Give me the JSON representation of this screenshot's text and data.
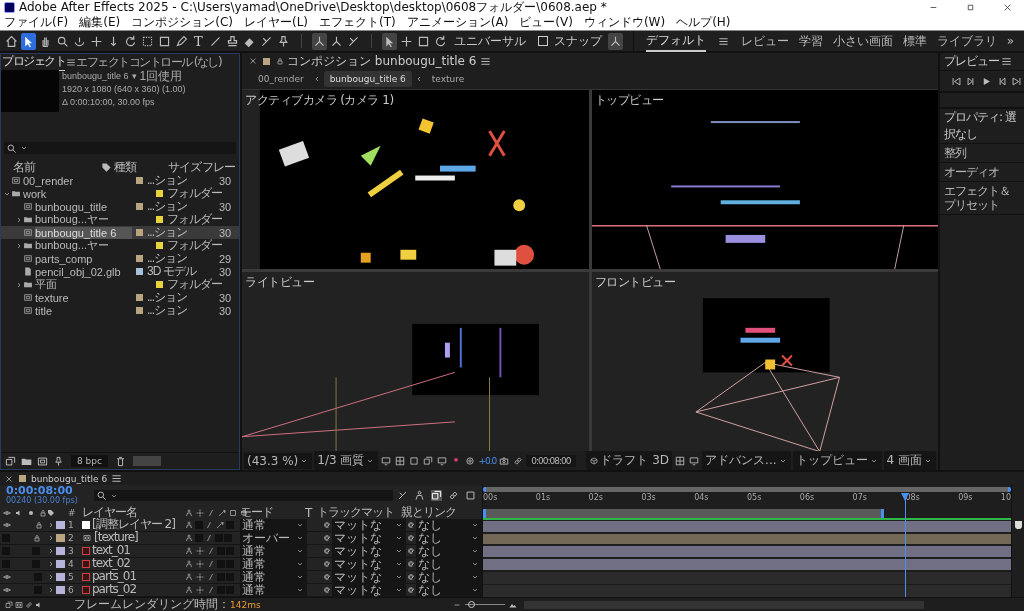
{
  "window": {
    "title": "Adobe After Effects 2025 - C:\\Users\\yamad\\OneDrive\\Desktop\\desktop\\0608フォルダー\\0608.aep *"
  },
  "menu": [
    "ファイル(F)",
    "編集(E)",
    "コンポジション(C)",
    "レイヤー(L)",
    "エフェクト(T)",
    "アニメーション(A)",
    "ビュー(V)",
    "ウィンドウ(W)",
    "ヘルプ(H)"
  ],
  "toolbar": {
    "tools": [
      {
        "kind": "home",
        "selected": false
      },
      {
        "kind": "select",
        "selected": true
      },
      {
        "kind": "hand",
        "selected": false
      },
      {
        "kind": "search",
        "selected": false
      },
      {
        "kind": "orbit",
        "selected": false
      },
      {
        "kind": "move",
        "selected": false
      },
      {
        "kind": "dolly",
        "selected": false
      },
      {
        "kind": "rotate",
        "selected": false
      },
      {
        "kind": "anchor",
        "selected": false
      },
      {
        "kind": "square",
        "selected": false
      },
      {
        "kind": "pen",
        "selected": false
      },
      {
        "kind": "text",
        "selected": false,
        "glyph": "T"
      },
      {
        "kind": "brush",
        "selected": false
      },
      {
        "kind": "stamp",
        "selected": false
      },
      {
        "kind": "eraser",
        "selected": false
      },
      {
        "kind": "branch",
        "selected": false
      },
      {
        "kind": "pin",
        "selected": false
      }
    ],
    "axis_tools": [
      {
        "kind": "axis",
        "selected": true
      },
      {
        "kind": "axis",
        "selected": false
      },
      {
        "kind": "branch",
        "selected": false
      }
    ],
    "gizmo_tools": [
      {
        "kind": "select",
        "selected": true
      },
      {
        "kind": "move",
        "selected": false
      },
      {
        "kind": "square",
        "selected": false
      },
      {
        "kind": "rotate",
        "selected": false
      }
    ],
    "universal_label": "ユニバーサル",
    "snap": {
      "label": "スナップ",
      "checked": false
    },
    "snap_extra": {
      "selected": true
    }
  },
  "workspaces": [
    {
      "label": "デフォルト",
      "selected": true
    },
    {
      "label": "レビュー",
      "selected": false
    },
    {
      "label": "学習",
      "selected": false
    },
    {
      "label": "小さい画面",
      "selected": false
    },
    {
      "label": "標準",
      "selected": false
    },
    {
      "label": "ライブラリ",
      "selected": false
    }
  ],
  "workspace_more": "»",
  "project": {
    "tabs": [
      {
        "label": "プロジェクト",
        "selected": true
      },
      {
        "label": "エフェクトコントロール (なし)",
        "selected": false
      }
    ],
    "info": {
      "name": "bunbougu_title 6",
      "caret": "▾",
      "usage": "1回使用",
      "size": "1920 x 1080  (640 x 360) (1.00)",
      "duration": "Δ 0:00:10:00, 30.00 fps"
    },
    "columns": [
      "名前",
      "種類",
      "サイズ",
      "フレー"
    ],
    "items": [
      {
        "name": "00_render",
        "kind": "comp",
        "color": "#b9a57f",
        "type": "...ション",
        "frame": "30",
        "selected": false
      },
      {
        "name": "work",
        "kind": "folder",
        "color": "#e6d43c",
        "type": "フォルダー",
        "selected": false,
        "expanded": true,
        "children": [
          {
            "name": "bunbougu_title",
            "kind": "comp",
            "color": "#b9a57f",
            "type": "...ション",
            "frame": "30",
            "selected": false
          },
          {
            "name": "bunboug...ヤー",
            "kind": "folder",
            "color": "#e6d43c",
            "type": "フォルダー",
            "selected": false,
            "expanded": false
          },
          {
            "name": "bunbougu_title 6",
            "kind": "comp",
            "color": "#b9a57f",
            "type": "...ション",
            "frame": "30",
            "selected": true
          },
          {
            "name": "bunboug...ヤー",
            "kind": "folder",
            "color": "#e6d43c",
            "type": "フォルダー",
            "selected": false,
            "expanded": false
          },
          {
            "name": "parts_comp",
            "kind": "comp",
            "color": "#b9a57f",
            "type": "...ション",
            "frame": "29",
            "selected": false
          },
          {
            "name": "pencil_obj_02.glb",
            "kind": "file",
            "color": "#a7c3dc",
            "type": "3D モデル",
            "frame": "30",
            "selected": false
          },
          {
            "name": "平面",
            "kind": "folder",
            "color": "#e6d43c",
            "type": "フォルダー",
            "selected": false,
            "expanded": false
          },
          {
            "name": "texture",
            "kind": "comp",
            "color": "#b9a57f",
            "type": "...ション",
            "frame": "30",
            "selected": false
          },
          {
            "name": "title",
            "kind": "comp",
            "color": "#b9a57f",
            "type": "...ション",
            "frame": "30",
            "selected": false
          }
        ]
      }
    ],
    "bpc": "8 bpc"
  },
  "viewer": {
    "tab": "コンポジション bunbougu_title 6",
    "breadcrumbs": [
      {
        "label": "00_render",
        "selected": false
      },
      {
        "label": "bunbougu_title 6",
        "selected": true
      },
      {
        "label": "texture",
        "selected": false
      }
    ],
    "views": [
      {
        "label": "アクティブカメラ (カメラ 1)",
        "kind": "camera"
      },
      {
        "label": "トップビュー",
        "kind": "top"
      },
      {
        "label": "ライトビュー",
        "kind": "right"
      },
      {
        "label": "フロントビュー",
        "kind": "front"
      }
    ],
    "bottom": {
      "zoom": "(43.3 %)",
      "quality": "1/3 画質",
      "exposure": "+0.0",
      "time": "0:00:08:00",
      "draft": "ドラフト 3D",
      "renderer": "アドバンス...",
      "view": "トップビュー",
      "layout": "4 画面"
    }
  },
  "right_panel": {
    "preview_title": "プレビュー",
    "properties_title": "プロパティ: 選択なし",
    "sections": [
      "整列",
      "オーディオ",
      "エフェクト＆プリセット"
    ]
  },
  "timeline": {
    "comp": "bunbougu_title 6",
    "time": "0:00:08:00",
    "frame": "00240 (30.00 fps)",
    "columns": {
      "index": "#",
      "name": "レイヤー名",
      "mode": "モード",
      "t": "T",
      "matte": "トラックマット",
      "parent": "親とリンク"
    },
    "ruler": [
      "00s",
      "01s",
      "02s",
      "03s",
      "04s",
      "05s",
      "06s",
      "07s",
      "08s",
      "09s",
      "10"
    ],
    "playhead": {
      "level": 0.8
    },
    "work_area": {
      "level": 0.76
    },
    "zoom": {
      "level": 0.15
    },
    "layers": [
      {
        "index": "1",
        "name": "[調整レイヤー 2]",
        "kind": "adjustment",
        "color": "#b7b4dc",
        "visible": true,
        "locked": true,
        "effects": true,
        "mode": "通常",
        "matte": "マットな",
        "parent": "なし",
        "bar": true
      },
      {
        "index": "2",
        "name": "[texture]",
        "kind": "comp",
        "color": "#b9a57f",
        "visible": false,
        "locked": true,
        "effects": false,
        "mode": "オーバー",
        "matte": "マットな",
        "parent": "なし",
        "bar": true
      },
      {
        "index": "3",
        "name": "text_01",
        "kind": "text",
        "color": "#b7b4dc",
        "visible": false,
        "locked": false,
        "effects": false,
        "mode": "通常",
        "matte": "マットな",
        "parent": "なし",
        "bar": true
      },
      {
        "index": "4",
        "name": "text_02",
        "kind": "text",
        "color": "#b7b4dc",
        "visible": false,
        "locked": false,
        "effects": false,
        "mode": "通常",
        "matte": "マットな",
        "parent": "なし",
        "bar": true
      },
      {
        "index": "5",
        "name": "parts_01",
        "kind": "text",
        "color": "#b7b4dc",
        "visible": true,
        "locked": false,
        "effects": false,
        "mode": "通常",
        "matte": "マットな",
        "parent": "なし",
        "bar": false
      },
      {
        "index": "6",
        "name": "parts_02",
        "kind": "text",
        "color": "#b7b4dc",
        "visible": true,
        "locked": false,
        "effects": false,
        "mode": "通常",
        "matte": "マットな",
        "parent": "なし",
        "bar": false
      }
    ],
    "render_label": "フレームレンダリング時間：",
    "render_time": "142ms"
  }
}
